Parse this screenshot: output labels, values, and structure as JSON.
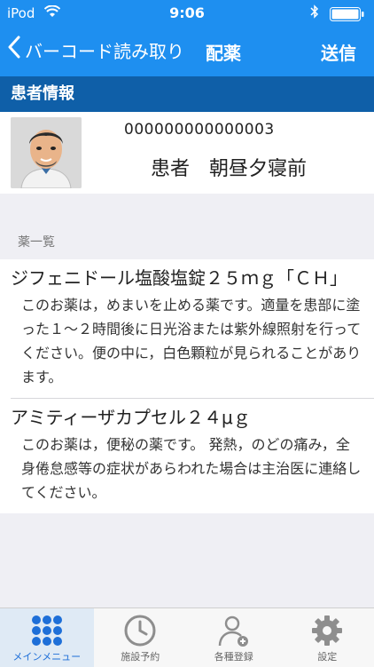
{
  "status_bar": {
    "carrier": "iPod",
    "time": "9:06"
  },
  "nav": {
    "back_label": "バーコード読み取り",
    "title": "配薬",
    "send_label": "送信"
  },
  "patient": {
    "section_title": "患者情報",
    "id": "000000000000003",
    "name": "患者　朝昼夕寝前"
  },
  "drugs": {
    "list_label": "薬一覧",
    "items": [
      {
        "name": "ジフェニドール塩酸塩錠２５ｍｇ「ＣＨ」",
        "description": "このお薬は，めまいを止める薬です。適量を患部に塗った１～２時間後に日光浴または紫外線照射を行ってください。便の中に，白色顆粒が見られることがあります。"
      },
      {
        "name": "アミティーザカプセル２４μｇ",
        "description": "このお薬は，便秘の薬です。 発熱，のどの痛み，全身倦怠感等の症状があらわれた場合は主治医に連絡してください。"
      }
    ]
  },
  "tabbar": {
    "items": [
      {
        "label": "メインメニュー",
        "icon": "grid-dots-icon",
        "active": true
      },
      {
        "label": "施設予約",
        "icon": "clock-icon",
        "active": false
      },
      {
        "label": "各種登録",
        "icon": "add-user-icon",
        "active": false
      },
      {
        "label": "設定",
        "icon": "gear-icon",
        "active": false
      }
    ]
  },
  "colors": {
    "nav_bg": "#1e8ff0",
    "section_bg": "#0f5fa8",
    "active_tab": "#1e6fd8"
  }
}
